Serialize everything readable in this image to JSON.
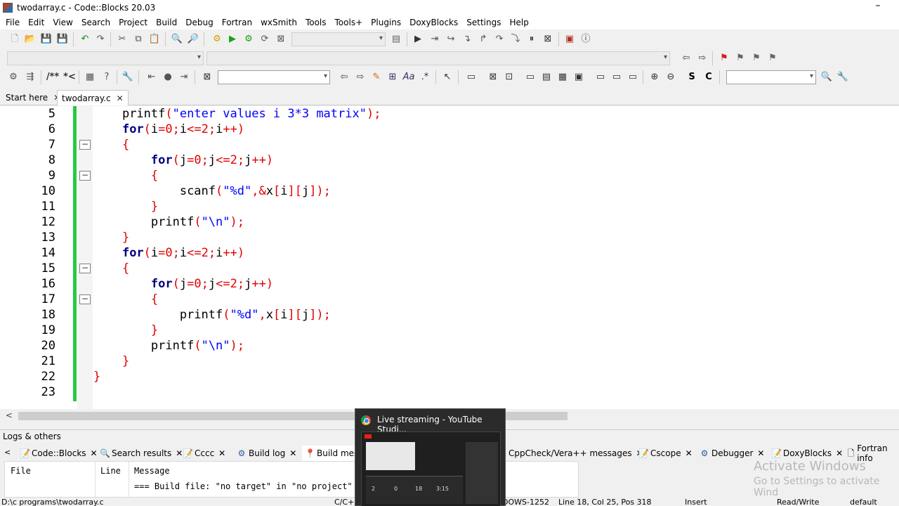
{
  "window": {
    "title": "twodarray.c - Code::Blocks 20.03"
  },
  "menu": [
    "File",
    "Edit",
    "View",
    "Search",
    "Project",
    "Build",
    "Debug",
    "Fortran",
    "wxSmith",
    "Tools",
    "Tools+",
    "Plugins",
    "DoxyBlocks",
    "Settings",
    "Help"
  ],
  "tabs": [
    {
      "label": "Start here"
    },
    {
      "label": "twodarray.c"
    }
  ],
  "editor": {
    "lines": [
      {
        "num": "5",
        "indent": "    ",
        "tokens": [
          [
            "fn",
            "printf"
          ],
          [
            "p",
            "("
          ],
          [
            "s",
            "\"enter values i 3*3 matrix\""
          ],
          [
            "p",
            ");"
          ]
        ]
      },
      {
        "num": "6",
        "indent": "    ",
        "tokens": [
          [
            "k",
            "for"
          ],
          [
            "p",
            "("
          ],
          [
            "i",
            "i"
          ],
          [
            "p",
            "="
          ],
          [
            "n",
            "0"
          ],
          [
            "p",
            ";"
          ],
          [
            "i",
            "i"
          ],
          [
            "p",
            "<="
          ],
          [
            "n",
            "2"
          ],
          [
            "p",
            ";"
          ],
          [
            "i",
            "i"
          ],
          [
            "p",
            "++)"
          ]
        ]
      },
      {
        "num": "7",
        "indent": "    ",
        "fold": true,
        "tokens": [
          [
            "p",
            "{"
          ]
        ]
      },
      {
        "num": "8",
        "indent": "        ",
        "tokens": [
          [
            "k",
            "for"
          ],
          [
            "p",
            "("
          ],
          [
            "i",
            "j"
          ],
          [
            "p",
            "="
          ],
          [
            "n",
            "0"
          ],
          [
            "p",
            ";"
          ],
          [
            "i",
            "j"
          ],
          [
            "p",
            "<="
          ],
          [
            "n",
            "2"
          ],
          [
            "p",
            ";"
          ],
          [
            "i",
            "j"
          ],
          [
            "p",
            "++)"
          ]
        ]
      },
      {
        "num": "9",
        "indent": "        ",
        "fold": true,
        "tokens": [
          [
            "p",
            "{"
          ]
        ]
      },
      {
        "num": "10",
        "indent": "            ",
        "tokens": [
          [
            "fn",
            "scanf"
          ],
          [
            "p",
            "("
          ],
          [
            "s",
            "\"%d\""
          ],
          [
            "p",
            ",&"
          ],
          [
            "i",
            "x"
          ],
          [
            "p",
            "["
          ],
          [
            "i",
            "i"
          ],
          [
            "p",
            "]["
          ],
          [
            "i",
            "j"
          ],
          [
            "p",
            "]);"
          ]
        ]
      },
      {
        "num": "11",
        "indent": "        ",
        "tokens": [
          [
            "p",
            "}"
          ]
        ]
      },
      {
        "num": "12",
        "indent": "        ",
        "tokens": [
          [
            "fn",
            "printf"
          ],
          [
            "p",
            "("
          ],
          [
            "s",
            "\"\\n\""
          ],
          [
            "p",
            ");"
          ]
        ]
      },
      {
        "num": "13",
        "indent": "    ",
        "tokens": [
          [
            "p",
            "}"
          ]
        ]
      },
      {
        "num": "14",
        "indent": "    ",
        "tokens": [
          [
            "k",
            "for"
          ],
          [
            "p",
            "("
          ],
          [
            "i",
            "i"
          ],
          [
            "p",
            "="
          ],
          [
            "n",
            "0"
          ],
          [
            "p",
            ";"
          ],
          [
            "i",
            "i"
          ],
          [
            "p",
            "<="
          ],
          [
            "n",
            "2"
          ],
          [
            "p",
            ";"
          ],
          [
            "i",
            "i"
          ],
          [
            "p",
            "++)"
          ]
        ]
      },
      {
        "num": "15",
        "indent": "    ",
        "fold": true,
        "tokens": [
          [
            "p",
            "{"
          ]
        ]
      },
      {
        "num": "16",
        "indent": "        ",
        "tokens": [
          [
            "k",
            "for"
          ],
          [
            "p",
            "("
          ],
          [
            "i",
            "j"
          ],
          [
            "p",
            "="
          ],
          [
            "n",
            "0"
          ],
          [
            "p",
            ";"
          ],
          [
            "i",
            "j"
          ],
          [
            "p",
            "<="
          ],
          [
            "n",
            "2"
          ],
          [
            "p",
            ";"
          ],
          [
            "i",
            "j"
          ],
          [
            "p",
            "++)"
          ]
        ]
      },
      {
        "num": "17",
        "indent": "        ",
        "fold": true,
        "tokens": [
          [
            "p",
            "{"
          ]
        ]
      },
      {
        "num": "18",
        "indent": "            ",
        "tokens": [
          [
            "fn",
            "printf"
          ],
          [
            "p",
            "("
          ],
          [
            "s",
            "\"%d\""
          ],
          [
            "p",
            ","
          ],
          [
            "i",
            "x"
          ],
          [
            "p",
            "["
          ],
          [
            "i",
            "i"
          ],
          [
            "p",
            "]["
          ],
          [
            "i",
            "j"
          ],
          [
            "p",
            "]);"
          ]
        ]
      },
      {
        "num": "19",
        "indent": "        ",
        "tokens": [
          [
            "p",
            "}"
          ]
        ]
      },
      {
        "num": "20",
        "indent": "        ",
        "tokens": [
          [
            "fn",
            "printf"
          ],
          [
            "p",
            "("
          ],
          [
            "s",
            "\"\\n\""
          ],
          [
            "p",
            ");"
          ]
        ]
      },
      {
        "num": "21",
        "indent": "    ",
        "tokens": [
          [
            "p",
            "}"
          ]
        ]
      },
      {
        "num": "22",
        "indent": "",
        "tokens": [
          [
            "p",
            "}"
          ]
        ]
      },
      {
        "num": "23",
        "indent": "",
        "tokens": []
      }
    ]
  },
  "colors": {
    "keyword": "#00007f",
    "string": "#0000ff",
    "number": "#e00000",
    "punct": "#e00000",
    "ident": "#000000",
    "change_bar": "#22cc44"
  },
  "logs": {
    "title": "Logs & others",
    "tabs": [
      "Code::Blocks",
      "Search results",
      "Cccc",
      "Build log",
      "Build mess",
      "CppCheck/Vera++ messages",
      "Cscope",
      "Debugger",
      "DoxyBlocks",
      "Fortran info"
    ],
    "columns": [
      "File",
      "Line",
      "Message"
    ],
    "message": "=== Build file: \"no target\" in \"no project\" ("
  },
  "watermark": {
    "line1": "Activate Windows",
    "line2": "Go to Settings to activate Wind"
  },
  "status": {
    "path": "D:\\c programs\\twodarray.c",
    "lang": "C/C+",
    "encoding": "DOWS-1252",
    "position": "Line 18, Col 25, Pos 318",
    "mode": "Insert",
    "access": "Read/Write",
    "profile": "default"
  },
  "popup": {
    "title": "Live streaming - YouTube Studi...",
    "nums": [
      "2",
      "0",
      "18",
      "3:15"
    ]
  }
}
